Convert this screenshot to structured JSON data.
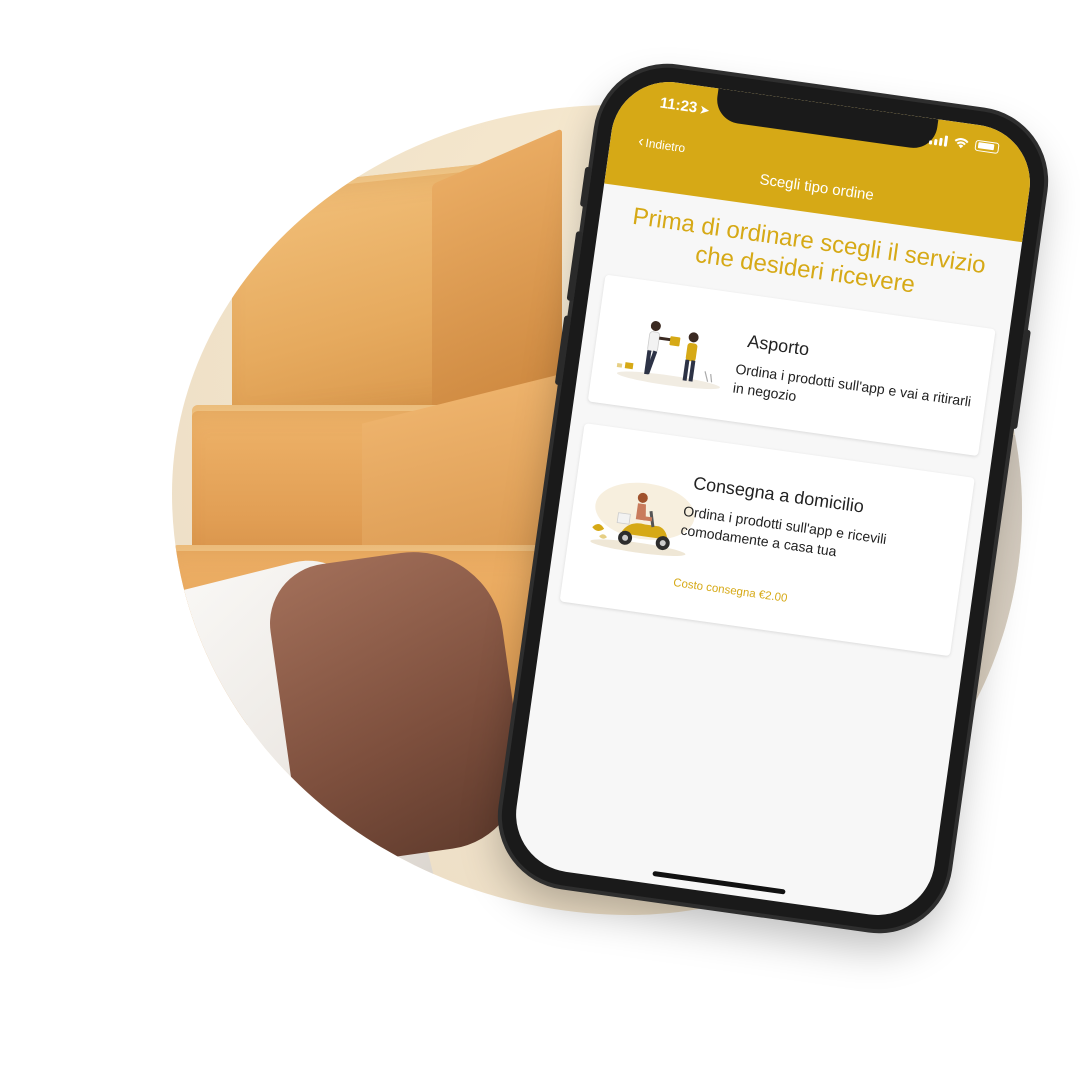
{
  "status_bar": {
    "time": "11:23",
    "location_arrow": "location-arrow-icon"
  },
  "nav": {
    "back_label": "Indietro",
    "title": "Scegli tipo ordine"
  },
  "headline": "Prima di ordinare scegli il servizio che desideri ricevere",
  "options": [
    {
      "title": "Asporto",
      "description": "Ordina i prodotti sull'app e vai a ritirarli in negozio",
      "illustration": "takeaway-illustration"
    },
    {
      "title": "Consegna a domicilio",
      "description": "Ordina i prodotti sull'app e ricevili comodamente a casa tua",
      "cost": "Costo consegna €2.00",
      "illustration": "scooter-delivery-illustration"
    }
  ],
  "colors": {
    "accent": "#d6a916",
    "background": "#f7f7f7",
    "card": "#ffffff"
  }
}
